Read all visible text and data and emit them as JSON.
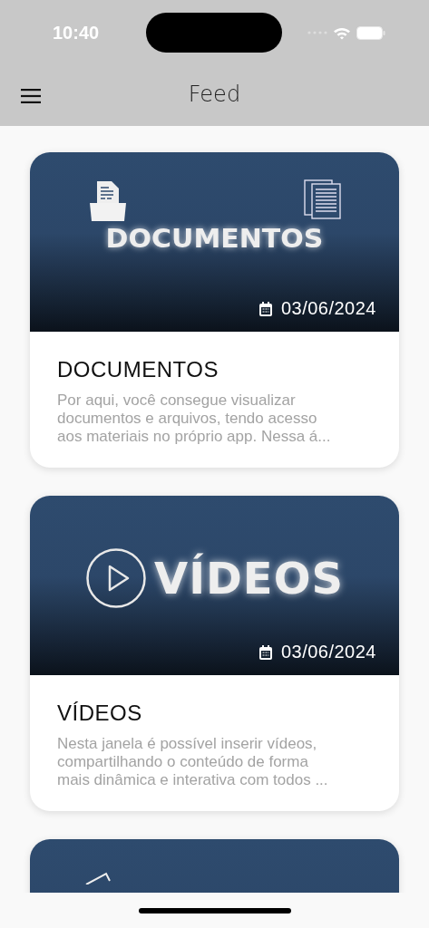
{
  "status_bar": {
    "time": "10:40"
  },
  "header": {
    "title": "Feed"
  },
  "cards": [
    {
      "kind": "documents",
      "banner_text": "DOCUMENTOS",
      "date": "03/06/2024",
      "title": "DOCUMENTOS",
      "description": "Por aqui, você consegue visualizar documentos e arquivos, tendo acesso aos materiais no próprio app. Nessa á..."
    },
    {
      "kind": "videos",
      "banner_text": "VÍDEOS",
      "date": "03/06/2024",
      "title": "VÍDEOS",
      "description": "Nesta janela é possível inserir vídeos, compartilhando o conteúdo de forma mais dinâmica e interativa com todos ..."
    },
    {
      "kind": "other"
    }
  ]
}
